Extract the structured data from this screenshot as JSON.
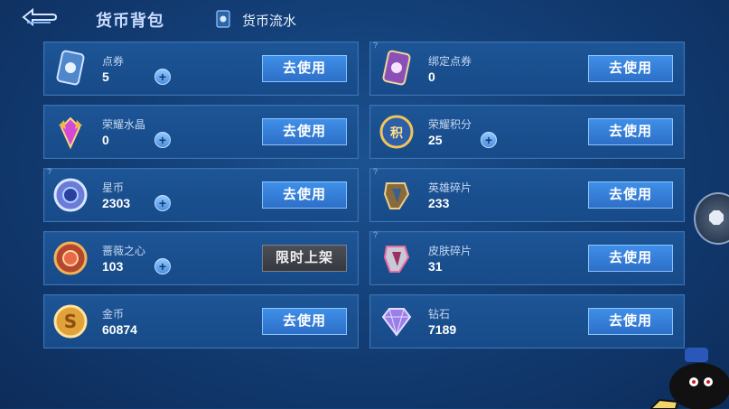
{
  "header": {
    "title": "货币背包",
    "flow_label": "货币流水"
  },
  "currencies": [
    {
      "name": "点券",
      "value": "5",
      "action": "去使用",
      "plus": true
    },
    {
      "name": "绑定点券",
      "value": "0",
      "action": "去使用",
      "plus": false
    },
    {
      "name": "荣耀水晶",
      "value": "0",
      "action": "去使用",
      "plus": true
    },
    {
      "name": "荣耀积分",
      "value": "25",
      "action": "去使用",
      "plus": true
    },
    {
      "name": "星币",
      "value": "2303",
      "action": "去使用",
      "plus": true
    },
    {
      "name": "英雄碎片",
      "value": "233",
      "action": "去使用",
      "plus": false
    },
    {
      "name": "蔷薇之心",
      "value": "103",
      "action": "限时上架",
      "plus": true
    },
    {
      "name": "皮肤碎片",
      "value": "31",
      "action": "去使用",
      "plus": false
    },
    {
      "name": "金币",
      "value": "60874",
      "action": "去使用",
      "plus": false
    },
    {
      "name": "钻石",
      "value": "7189",
      "action": "去使用",
      "plus": false
    }
  ],
  "icons": {
    "back": "back-arrow-icon",
    "flow": "currency-flow-icon",
    "side": "settings-icon"
  },
  "colors": {
    "background": "#133f77",
    "card": "#1d5596",
    "button": "#3f8fe8",
    "button_disabled": "#4b4f57"
  }
}
